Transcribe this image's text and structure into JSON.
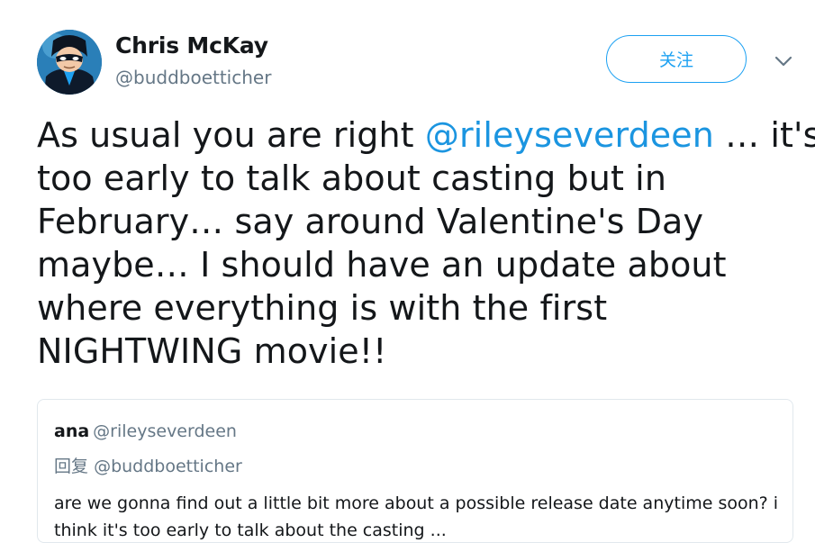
{
  "tweet": {
    "author": {
      "display_name": "Chris McKay",
      "screen_name": "@buddboetticher",
      "avatar_icon": "nightwing-avatar"
    },
    "follow_label": "关注",
    "menu_icon": "chevron-down-icon",
    "text": {
      "line1_before": "As usual you are right ",
      "mention": "@rileyseverdeen",
      "line1_after": " … it's",
      "line2": "too early to talk about casting but in",
      "line3": "February… say around Valentine's Day",
      "line4": "maybe… I should have an update about",
      "line5": "where everything is with the first",
      "line6": "NIGHTWING movie!!"
    }
  },
  "quoted_tweet": {
    "name": "ana",
    "handle": "@rileyseverdeen",
    "reply_label": "回复",
    "reply_to": "@buddboetticher",
    "text_line1": "are we gonna find out a little bit more about a possible release date anytime soon? i",
    "text_line2": "think it's too early to talk about the casting ..."
  },
  "colors": {
    "accent": "#1da1f2",
    "mention": "#1b95e0",
    "text": "#14171a",
    "secondary": "#657786",
    "border": "#e1e8ed"
  }
}
